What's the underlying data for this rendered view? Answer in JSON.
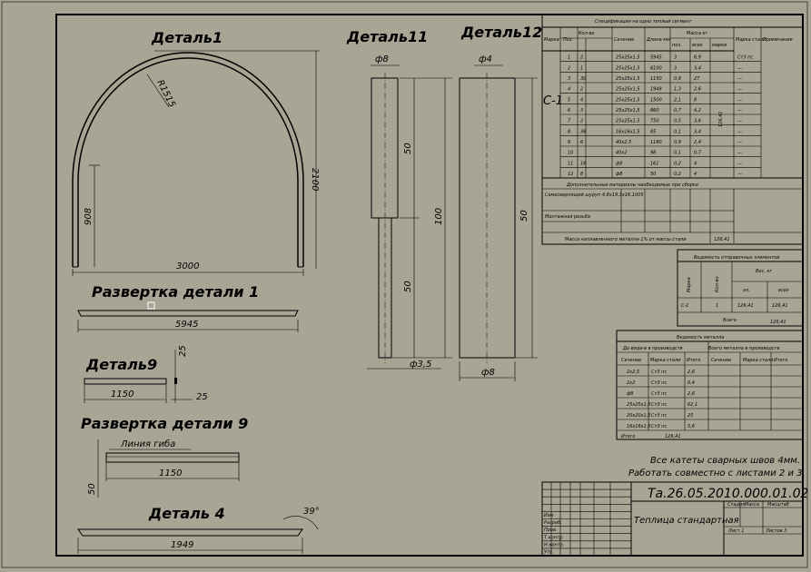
{
  "drawing": {
    "titles": {
      "detail1": "Деталь1",
      "detail11": "Деталь11",
      "detail12": "Деталь12",
      "unfold1": "Развертка детали 1",
      "detail9": "Деталь9",
      "unfold9": "Развертка детали 9",
      "detail4": "Деталь 4"
    },
    "dims": {
      "radius": "R1515",
      "height_2100": "2100",
      "height_908": "908",
      "width_3000": "3000",
      "length_5945": "5945",
      "length_1150a": "1150",
      "length_1150b": "1150",
      "dim_25a": "25",
      "dim_25b": "25",
      "dim_50_unfold9": "50",
      "bend_line": "Линия гиба",
      "length_1949": "1949",
      "angle_39": "39°",
      "dia8_top": "ф8",
      "d11_50a": "50",
      "d11_100": "100",
      "d11_50b": "50",
      "dia35": "ф3,5",
      "dia4": "ф4",
      "d12_50": "50",
      "dia8_bottom": "ф8"
    },
    "spec": {
      "title": "Спецификация на одно теплый сегмент",
      "headers": [
        "Марка",
        "Поз",
        "Кол-во",
        "Сечение",
        "Длина мм",
        "Масса кг",
        "Марка стали",
        "Примечание"
      ],
      "mass_sub": [
        "поз.",
        "всех",
        "марки"
      ],
      "mark": "С-1",
      "total_mass": "126,41",
      "rows": [
        {
          "n": "1",
          "q": "2",
          "sec": "25х25х1,5",
          "len": "5945",
          "m": "3",
          "all": "6,9",
          "st": "Ст3 пс"
        },
        {
          "n": "2",
          "q": "1",
          "sec": "25х25х1,5",
          "len": "6100",
          "m": "3",
          "all": "3,4",
          "st": "—"
        },
        {
          "n": "3",
          "q": "30",
          "sec": "25х25х1,5",
          "len": "1150",
          "m": "0,9",
          "all": "27",
          "st": "—"
        },
        {
          "n": "4",
          "q": "2",
          "sec": "25х25х1,5",
          "len": "1949",
          "m": "1,3",
          "all": "2,6",
          "st": "—"
        },
        {
          "n": "5",
          "q": "4",
          "sec": "25х25х1,5",
          "len": "1500",
          "m": "2,1",
          "all": "8",
          "st": "—"
        },
        {
          "n": "6",
          "q": "3",
          "sec": "25х25х1,5",
          "len": "860",
          "m": "0,7",
          "all": "4,2",
          "st": "—"
        },
        {
          "n": "7",
          "q": "2",
          "sec": "25х25х1,5",
          "len": "750",
          "m": "0,5",
          "all": "3,6",
          "st": "—"
        },
        {
          "n": "8",
          "q": "38",
          "sec": "16х16х1,5",
          "len": "85",
          "m": "0,1",
          "all": "3,4",
          "st": "—"
        },
        {
          "n": "9",
          "q": "6",
          "sec": "40х2,5",
          "len": "1180",
          "m": "0,9",
          "all": "2,4",
          "st": "—"
        },
        {
          "n": "10",
          "q": "",
          "sec": "40х2",
          "len": "98",
          "m": "0,1",
          "all": "0,7",
          "st": "—"
        },
        {
          "n": "11",
          "q": "16",
          "sec": "ф8",
          "len": "161",
          "m": "0,2",
          "all": "4",
          "st": "—"
        },
        {
          "n": "12",
          "q": "8",
          "sec": "ф8",
          "len": "50",
          "m": "0,2",
          "all": "4",
          "st": "—"
        }
      ],
      "extra_title": "Дополнительные материалы необходимые при сборке",
      "extra_rows": [
        "Самосверлящий шуруп 4,8х19,3х16,1005",
        "Монтажная резьба"
      ],
      "extra_note": "Масса наплавленного металла 1% от массы стали",
      "extra_note_val": "126,41"
    },
    "elements": {
      "title": "Ведомость отправочных элементов",
      "h_mark": "Марка",
      "h_qty": "Кол-во",
      "h_mass": "Вес, кг",
      "h_el": "эл.",
      "h_total": "всех",
      "row": {
        "mark": "С-1",
        "qty": "1",
        "m1": "126,41",
        "m2": "126,41"
      },
      "total_label": "Всего",
      "total_val": "126,41"
    },
    "steel": {
      "title": "Ведомость металла",
      "left_head": "До вида-в в производств",
      "right_head": "Всего металла в производств",
      "cols": [
        "Сечение",
        "Марка стали",
        "Итого"
      ],
      "rows": [
        {
          "sec": "2х2,5",
          "st": "Ст3 пс",
          "v": "2,6"
        },
        {
          "sec": "2х2",
          "st": "Ст3 пс",
          "v": "0,4"
        },
        {
          "sec": "ф8",
          "st": "Ст3 пс",
          "v": "2,6"
        },
        {
          "sec": "25х25х1,5",
          "st": "Ст3 пс",
          "v": "62,1"
        },
        {
          "sec": "20х20х1,5",
          "st": "Ст3 пс",
          "v": "25"
        },
        {
          "sec": "16х16х1,5",
          "st": "Ст3 пс",
          "v": "5,6"
        }
      ],
      "total_label": "Итого",
      "total_val": "126,41"
    },
    "notes": [
      "Все катеты сварных швов 4мм.",
      "Работать совместно с листами 2 и 3."
    ],
    "stamp": {
      "code": "Та.26.05.2010.000.01.02",
      "name": "Теплица стандартная",
      "cols": [
        "Стадия",
        "Масса",
        "Масштаб"
      ],
      "sheet": "Лист 1",
      "sheets": "Листов 3",
      "left_labels": [
        "Изм",
        "Разраб.",
        "Пров.",
        "Т.контр.",
        "Н.контр.",
        "Утв."
      ]
    }
  }
}
